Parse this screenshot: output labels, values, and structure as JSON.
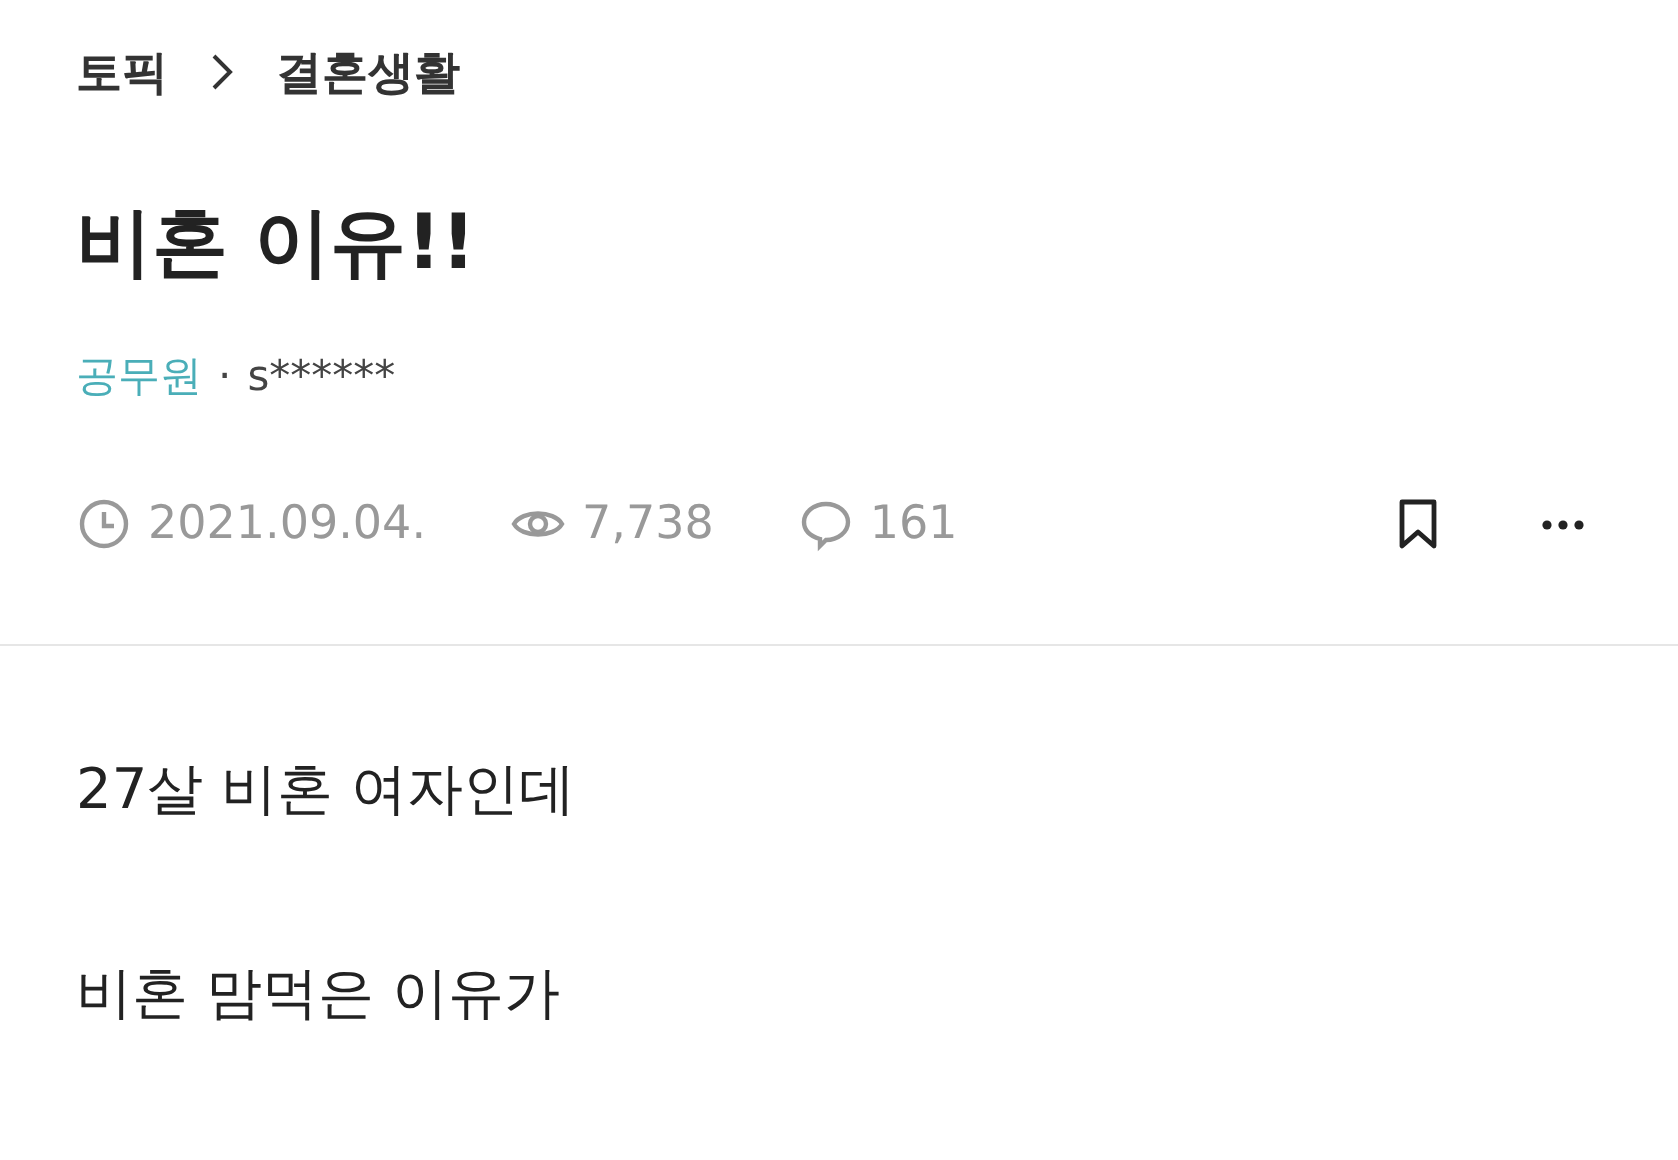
{
  "breadcrumb": [
    "토픽",
    "결혼생활"
  ],
  "title": "비혼 이유!!",
  "author": {
    "company": "공무원",
    "separator": "·",
    "name": "s******"
  },
  "meta": [
    {
      "kind": "date",
      "text": "2021.09.04."
    },
    {
      "kind": "views",
      "text": "7,738"
    },
    {
      "kind": "comments",
      "text": "161"
    }
  ],
  "actions": [
    {
      "kind": "bookmark"
    },
    {
      "kind": "more"
    }
  ],
  "body": [
    "27살 비혼 여자인데",
    "비혼 맘먹은 이유가"
  ]
}
